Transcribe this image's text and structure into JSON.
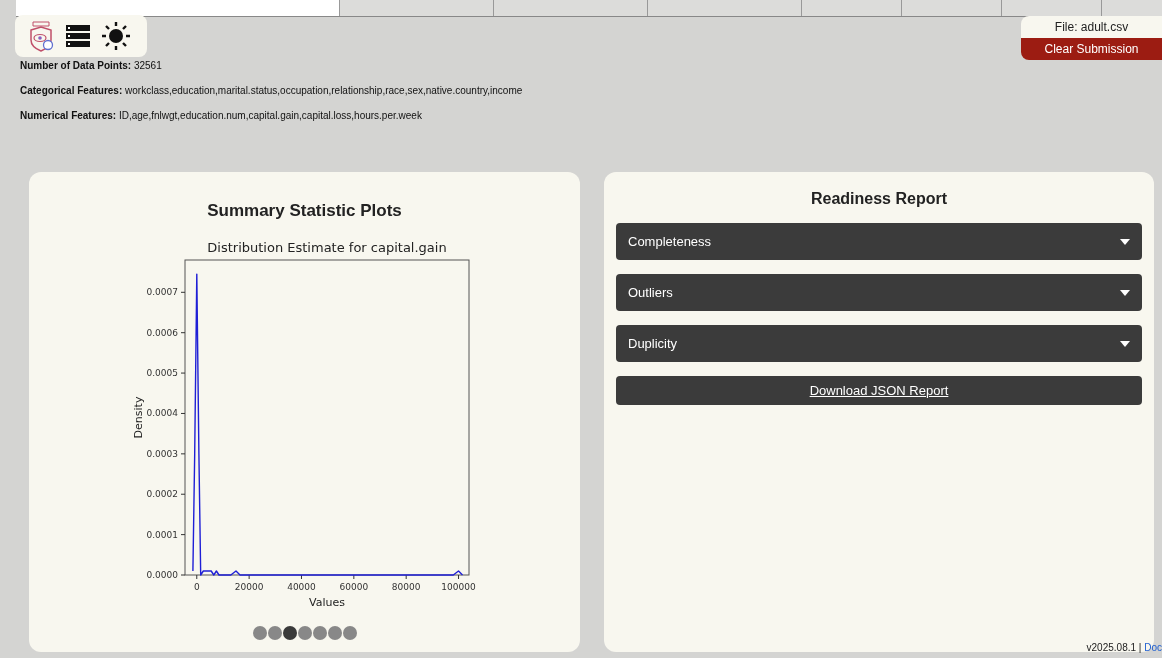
{
  "file_box": {
    "file_label": "File: adult.csv",
    "clear_button": "Clear Submission"
  },
  "info": [
    {
      "label": "Number of Data Points:",
      "value": "32561"
    },
    {
      "label": "Categorical Features:",
      "value": "workclass,education,marital.status,occupation,relationship,race,sex,native.country,income"
    },
    {
      "label": "Numerical Features:",
      "value": "ID,age,fnlwgt,education.num,capital.gain,capital.loss,hours.per.week"
    }
  ],
  "summary_panel": {
    "title": "Summary Statistic Plots",
    "chart_data": {
      "type": "line",
      "title": "Distribution Estimate for capital.gain",
      "xlabel": "Values",
      "ylabel": "Density",
      "x": [
        -1500,
        -800,
        0,
        800,
        1500,
        2500,
        4000,
        5500,
        6500,
        7500,
        8500,
        10000,
        13000,
        15000,
        16500,
        20000,
        30000,
        60000,
        98000,
        100000,
        101500
      ],
      "series": [
        {
          "color": "#1f1fd6",
          "values": [
            1e-05,
            0.0003,
            0.000745,
            0.0003,
            0,
            1e-05,
            1e-05,
            1e-05,
            0,
            1e-05,
            0,
            0,
            0,
            1e-05,
            0,
            0,
            0,
            0,
            0,
            1e-05,
            0
          ]
        }
      ],
      "xlim": [
        -4500,
        104000
      ],
      "ylim": [
        0,
        0.00078
      ],
      "xticks": [
        0,
        20000,
        40000,
        60000,
        80000,
        100000
      ],
      "yticks": [
        {
          "value": 0,
          "label": "0.0000"
        },
        {
          "value": 0.0001,
          "label": "0.0001"
        },
        {
          "value": 0.0002,
          "label": "0.0002"
        },
        {
          "value": 0.0003,
          "label": "0.0003"
        },
        {
          "value": 0.0004,
          "label": "0.0004"
        },
        {
          "value": 0.0005,
          "label": "0.0005"
        },
        {
          "value": 0.0006,
          "label": "0.0006"
        },
        {
          "value": 0.0007,
          "label": "0.0007"
        }
      ]
    },
    "pager": [
      {
        "selected": false
      },
      {
        "selected": false
      },
      {
        "selected": true
      },
      {
        "selected": false
      },
      {
        "selected": false
      },
      {
        "selected": false
      },
      {
        "selected": false
      }
    ]
  },
  "readiness_panel": {
    "title": "Readiness Report",
    "sections": [
      {
        "label": "Completeness",
        "expanded": false
      },
      {
        "label": "Outliers",
        "expanded": false
      },
      {
        "label": "Duplicity",
        "expanded": false
      }
    ],
    "download_button": "Download JSON Report"
  },
  "footer": {
    "version": "v2025.08.1 |",
    "link": "Doc"
  }
}
